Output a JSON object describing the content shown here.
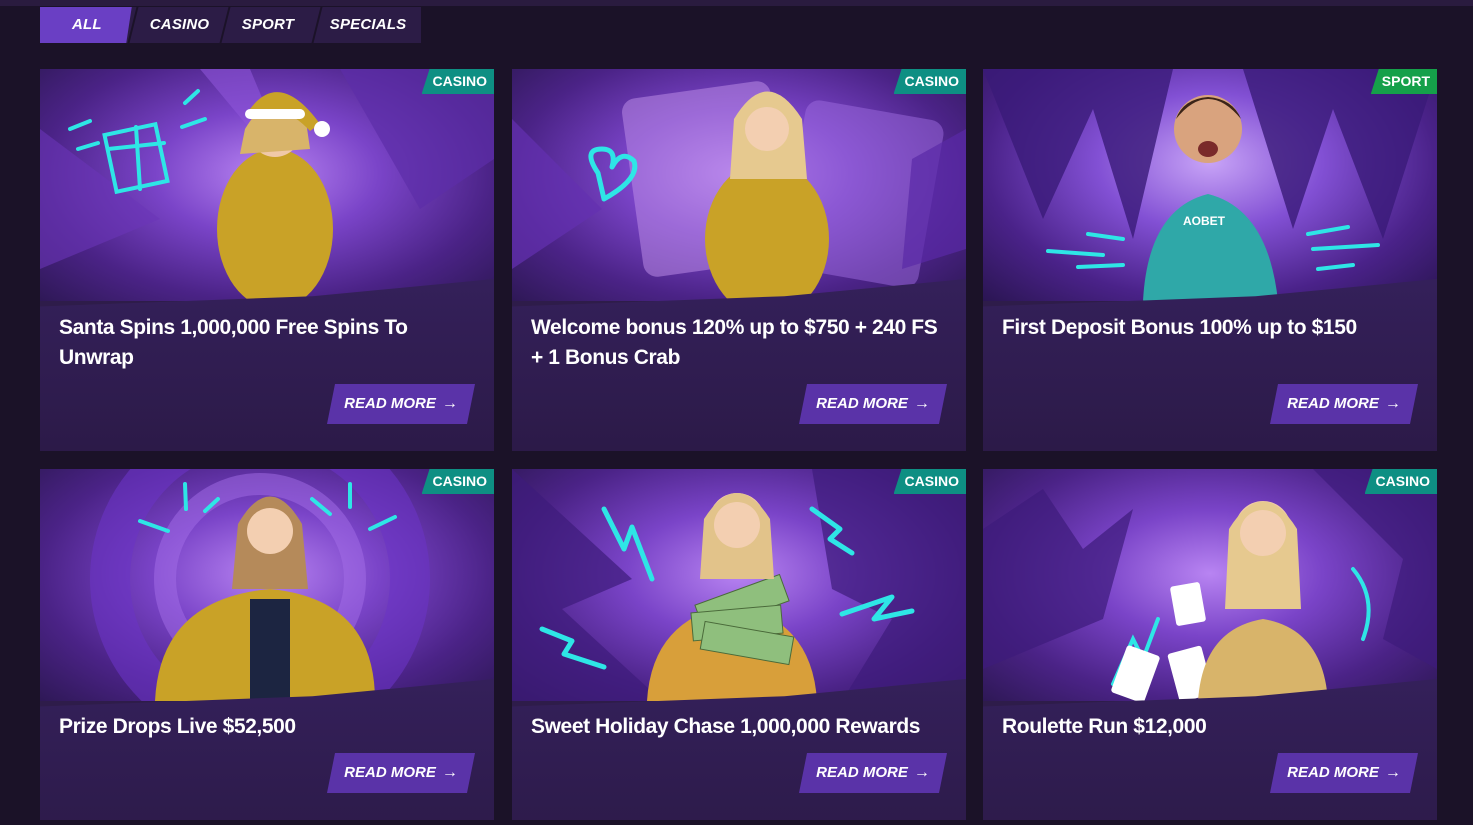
{
  "filters": {
    "tabs": [
      "ALL",
      "CASINO",
      "SPORT",
      "SPECIALS"
    ],
    "active": "ALL"
  },
  "cards": [
    {
      "category": "CASINO",
      "title": "Santa Spins 1,000,000 Free Spins To Unwrap",
      "cta": "READ MORE"
    },
    {
      "category": "CASINO",
      "title": "Welcome bonus 120% up to $750 + 240 FS + 1 Bonus Crab",
      "cta": "READ MORE"
    },
    {
      "category": "SPORT",
      "title": "First Deposit Bonus 100% up to $150",
      "cta": "READ MORE"
    },
    {
      "category": "CASINO",
      "title": "Prize Drops Live $52,500",
      "cta": "READ MORE"
    },
    {
      "category": "CASINO",
      "title": "Sweet Holiday Chase 1,000,000 Rewards",
      "cta": "READ MORE"
    },
    {
      "category": "CASINO",
      "title": "Roulette Run $12,000",
      "cta": "READ MORE"
    }
  ],
  "icons": {
    "arrow": "arrow-right-icon"
  },
  "colors": {
    "background": "#1b1228",
    "card": "#2e1c4a",
    "accent": "#6a3fc4",
    "button": "#5a33a8",
    "casino_badge": "#0e8f83",
    "sport_badge": "#15a04a",
    "neon": "#2ee6e6"
  }
}
